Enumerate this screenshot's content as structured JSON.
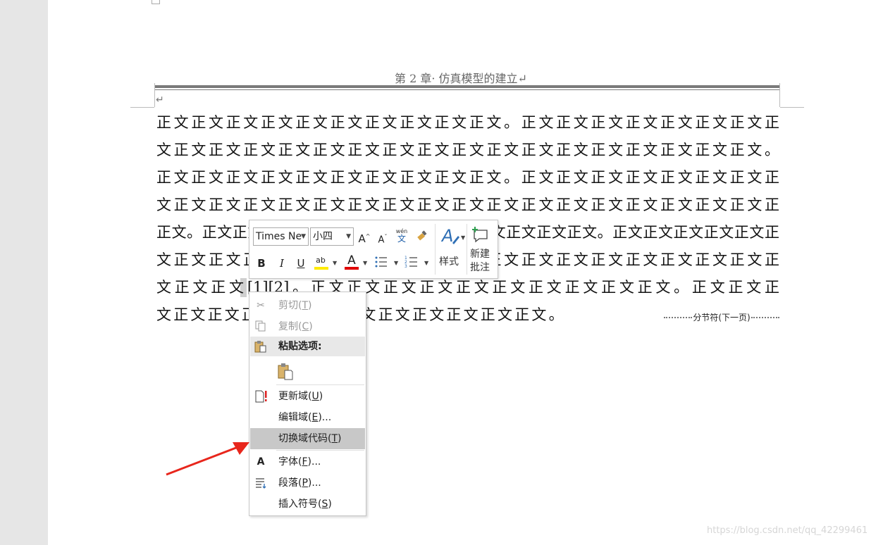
{
  "document": {
    "header_text": "第 2 章· 仿真模型的建立↵",
    "paragraph_mark": "↵",
    "lines": [
      "正文正文正文正文正文正文正文正文正文正文。正文正文正文正文正文正文正文正",
      "文正文正文正文正文正文正文正文正文正文正文正文正文正文正文正文正文正文。",
      "正文正文正文正文正文正文正文正文正文正文。正文正文正文正文正文正文正文正",
      "文正文正文正文正文正文正文正文正文正文正文正文正文正文正文正文正文正文正",
      "正文。正文正文正文正文正文正文正文正文正文正文正文正文正文。正文正文正文正文正文正",
      "文正文正文正文正文正文正文正文正文正文正文正文正文正文正文正文正文正文正",
      "文正文正文[1][2]。正文正文正文正文正文正文正文正文正文正文。正文正文正",
      "文正文正文正文正文正文正文正文正文正文正文正文。"
    ],
    "section_break_label": "分节符(下一页)"
  },
  "mini_toolbar": {
    "font_name": "Times Ne",
    "font_size": "小四",
    "grow_font": "A",
    "shrink_font": "A",
    "phonetic": "wén",
    "phonetic_char": "文",
    "bold": "B",
    "italic": "I",
    "underline": "U",
    "highlight": "ab",
    "font_color": "A",
    "styles_label": "样式",
    "new_comment_line1": "新建",
    "new_comment_line2": "批注"
  },
  "context_menu": {
    "cut": "剪切(",
    "cut_key": "T",
    "copy": "复制(",
    "copy_key": "C",
    "paste_options": "粘贴选项:",
    "update_field": "更新域(",
    "update_field_key": "U",
    "edit_field": "编辑域(",
    "edit_field_key": "E",
    "edit_field_suffix": ")...",
    "toggle_field_codes": "切换域代码(",
    "toggle_field_codes_key": "T",
    "font": "字体(",
    "font_key": "F",
    "paragraph": "段落(",
    "paragraph_key": "P",
    "insert_symbol": "插入符号(",
    "insert_symbol_key": "S",
    "close_paren": ")",
    "ellipsis_suffix": ")..."
  },
  "watermark": "https://blog.csdn.net/qq_42299461",
  "colors": {
    "highlight_yellow": "#ffeb00",
    "font_color_red": "#e00000",
    "arrow_red": "#e8261c"
  }
}
